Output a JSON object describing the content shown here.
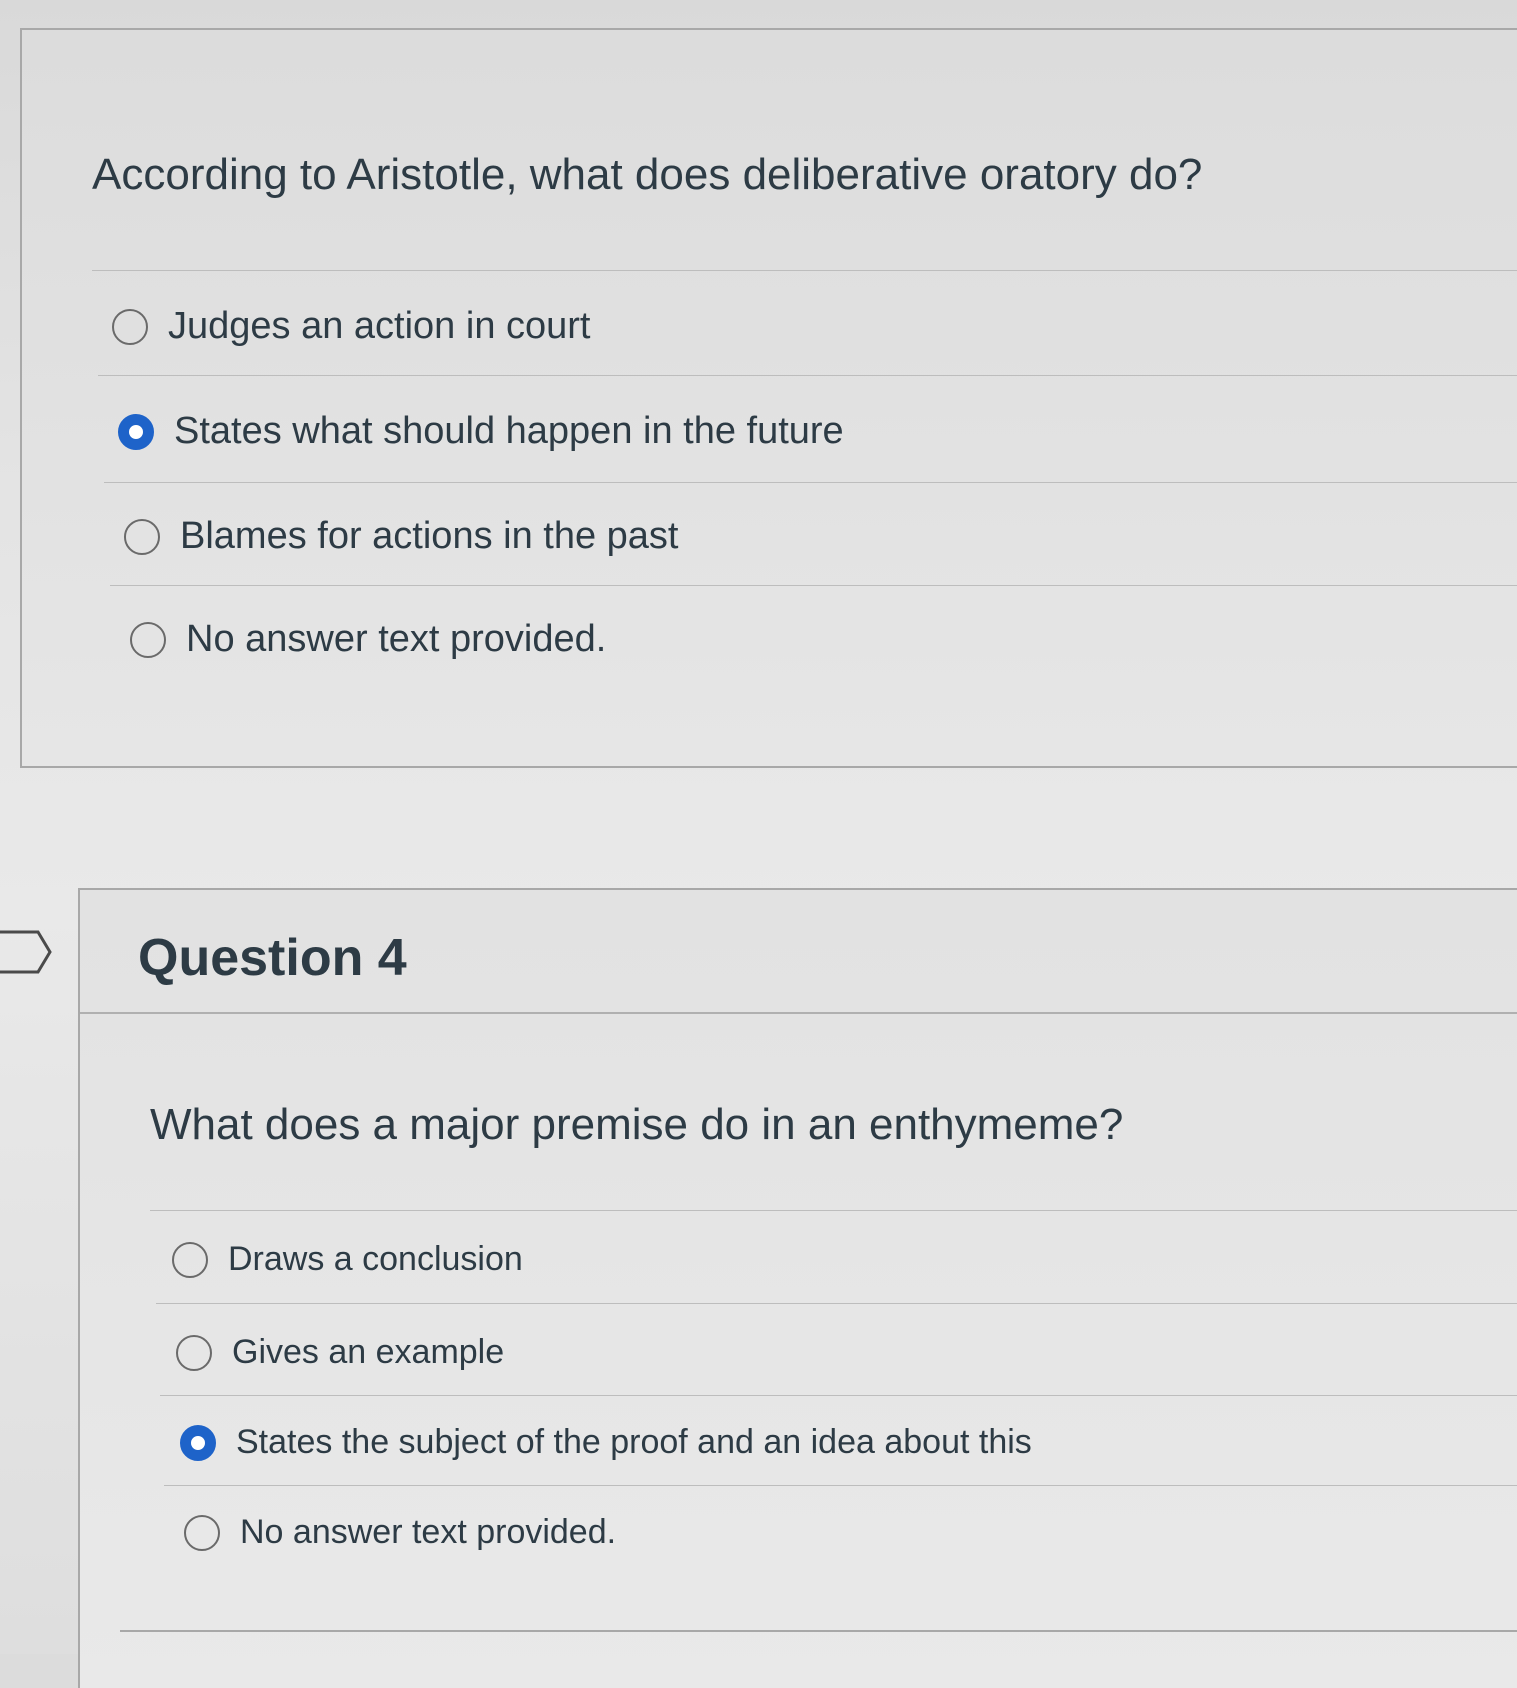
{
  "question3": {
    "text": "According to Aristotle, what does deliberative oratory do?",
    "answers": [
      {
        "label": "Judges an action in court",
        "selected": false
      },
      {
        "label": "States what should happen in the future",
        "selected": true
      },
      {
        "label": "Blames for actions in the past",
        "selected": false
      },
      {
        "label": "No answer text provided.",
        "selected": false
      }
    ]
  },
  "question4": {
    "title": "Question 4",
    "flag_icon": "flag-outline-icon",
    "text": "What does a major premise do in an enthymeme?",
    "answers": [
      {
        "label": "Draws a conclusion",
        "selected": false
      },
      {
        "label": "Gives an example",
        "selected": false
      },
      {
        "label": "States the subject of the proof and an idea about this",
        "selected": true
      },
      {
        "label": "No answer text provided.",
        "selected": false
      }
    ]
  },
  "colors": {
    "radio_selected": "#1e63c9",
    "text": "#2d3b45"
  }
}
